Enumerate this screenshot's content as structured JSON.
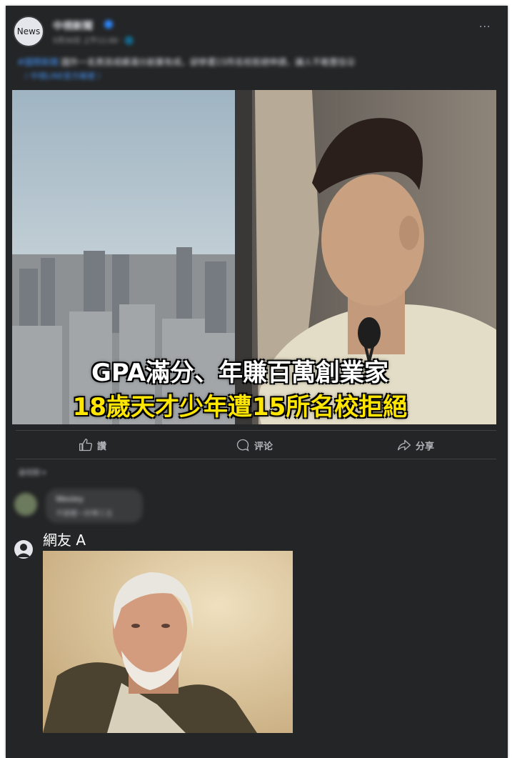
{
  "post": {
    "avatar_text": "News",
    "page_name": "中視新聞",
    "meta": "5月30日 上午11:00 · 🌐",
    "more": "···",
    "caption_tag": "#國際新聞",
    "caption_text": "國外一名男孩成績滿分創業有成，卻慘遭15所名校拒絕申請，讓人不敢置信😮",
    "caption_link": "（ 中視LINE官方帳號 ）"
  },
  "photo": {
    "headline_line1": "GPA滿分、年賺百萬創業家",
    "headline_line2": "18歲天才少年遭15所名校拒絕"
  },
  "actions": {
    "like": "讚",
    "comment": "评论",
    "share": "分享"
  },
  "comments": {
    "sort_label": "最相關 ▾",
    "first_name": "Wesley",
    "first_text": "不錯喔～好棒三五"
  },
  "reply": {
    "name": "網友 A"
  },
  "colors": {
    "background": "#242526",
    "headline_yellow": "#ffe600",
    "verified_blue": "#2d88ff"
  }
}
